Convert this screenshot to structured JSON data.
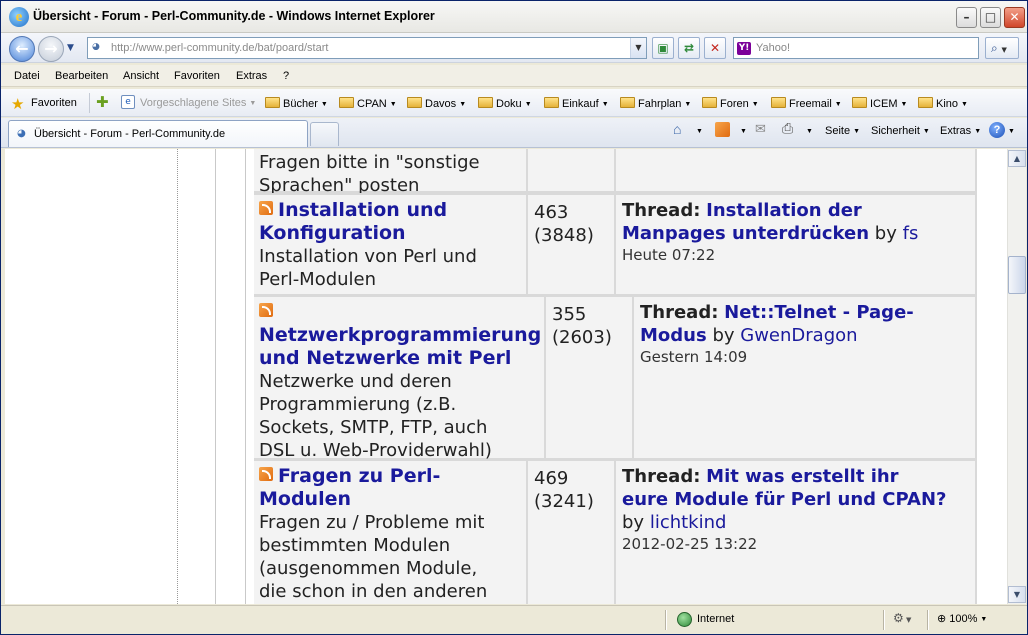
{
  "window": {
    "title": "Übersicht - Forum - Perl-Community.de - Windows Internet Explorer",
    "minimize": "–",
    "maximize": "□",
    "close": "✕"
  },
  "address": {
    "url": "http://www.perl-community.de/bat/poard/start"
  },
  "search": {
    "placeholder": "Yahoo!",
    "engine_icon": "Y!"
  },
  "menu": [
    "Datei",
    "Bearbeiten",
    "Ansicht",
    "Favoriten",
    "Extras",
    "?"
  ],
  "favorites_bar": {
    "favorites_label": "Favoriten",
    "suggested": "Vorgeschlagene Sites",
    "folders": [
      "Bücher",
      "CPAN",
      "Davos",
      "Doku",
      "Einkauf",
      "Fahrplan",
      "Foren",
      "Freemail",
      "ICEM",
      "Kino"
    ]
  },
  "tab": {
    "label": "Übersicht - Forum - Perl-Community.de"
  },
  "command_bar": {
    "page": "Seite",
    "safety": "Sicherheit",
    "tools": "Extras"
  },
  "forum": {
    "top_fragment": {
      "line1": "Fragen bitte in \"sonstige",
      "line2": "Sprachen\" posten"
    },
    "rows": [
      {
        "title_l1": "Installation und",
        "title_l2": "Konfiguration",
        "desc": [
          "Installation von Perl und",
          "Perl-Modulen"
        ],
        "topics": "463",
        "posts": "(3848)",
        "thread_label": "Thread:",
        "thread_l1": "Installation der",
        "thread_l2": "Manpages unterdrücken",
        "by": "by",
        "user": "fs",
        "date": "Heute 07:22"
      },
      {
        "title_l1": "Netzwerkprogrammierung",
        "title_l2": "und Netzwerke mit Perl",
        "desc": [
          "Netzwerke und deren",
          "Programmierung (z.B.",
          "Sockets, SMTP, FTP, auch",
          "DSL u. Web-Providerwahl)"
        ],
        "topics": "355",
        "posts": "(2603)",
        "thread_label": "Thread:",
        "thread_l1": "Net::Telnet - Page-",
        "thread_l2": "Modus",
        "by": "by",
        "user": "GwenDragon",
        "date": "Gestern 14:09"
      },
      {
        "title_l1": "Fragen zu Perl-",
        "title_l2": "Modulen",
        "desc": [
          "Fragen zu / Probleme mit",
          "bestimmten Modulen",
          "(ausgenommen Module,",
          "die schon in den anderen"
        ],
        "topics": "469",
        "posts": "(3241)",
        "thread_label": "Thread:",
        "thread_l1": "Mit was erstellt ihr",
        "thread_l2": "eure Module für Perl und CPAN?",
        "by": "by",
        "user": "lichtkind",
        "date": "2012-02-25 13:22"
      }
    ]
  },
  "status": {
    "zone": "Internet",
    "zoom": "100%"
  }
}
